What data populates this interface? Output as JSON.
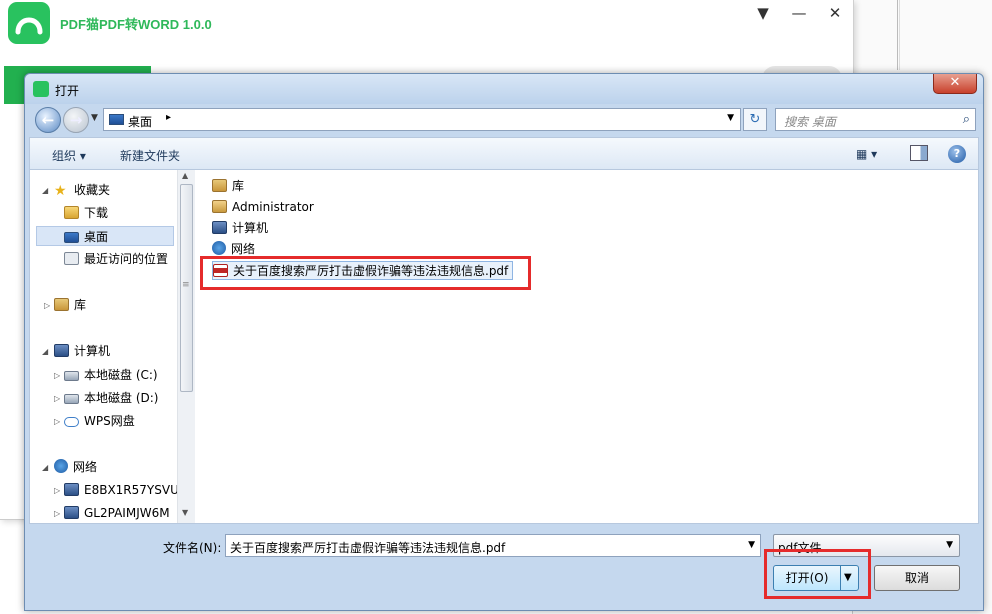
{
  "app": {
    "title": "PDF猫PDF转WORD 1.0.0",
    "accent": "#29c25f",
    "win_controls": [
      "▼",
      "—",
      "✕"
    ]
  },
  "dialog": {
    "title": "打开",
    "close_label": "✕",
    "nav": {
      "back_label": "←",
      "forward_label": "→",
      "address": "桌面",
      "refresh_label": "↻",
      "search_placeholder": "搜索 桌面",
      "search_icon": "⌕"
    },
    "toolbar": {
      "organize": "组织 ▾",
      "new_folder": "新建文件夹",
      "view_label": "▦ ▾",
      "help_label": "?"
    },
    "nav_pane": {
      "favorites": "收藏夹",
      "downloads": "下载",
      "desktop": "桌面",
      "recent": "最近访问的位置",
      "libraries": "库",
      "computer": "计算机",
      "drive_c": "本地磁盘 (C:)",
      "drive_d": "本地磁盘 (D:)",
      "wps": "WPS网盘",
      "network": "网络",
      "net_pc1": "E8BX1R57YSVU",
      "net_pc2": "GL2PAIMJW6M"
    },
    "files": [
      "库",
      "Administrator",
      "计算机",
      "网络",
      "关于百度搜索严厉打击虚假诈骗等违法违规信息.pdf"
    ],
    "filename_label": "文件名(N):",
    "filename_value": "关于百度搜索严厉打击虚假诈骗等违法违规信息.pdf",
    "filetype_value": "pdf文件",
    "open_button": "打开(O)",
    "cancel_button": "取消",
    "highlight_color": "#e52b2b"
  }
}
